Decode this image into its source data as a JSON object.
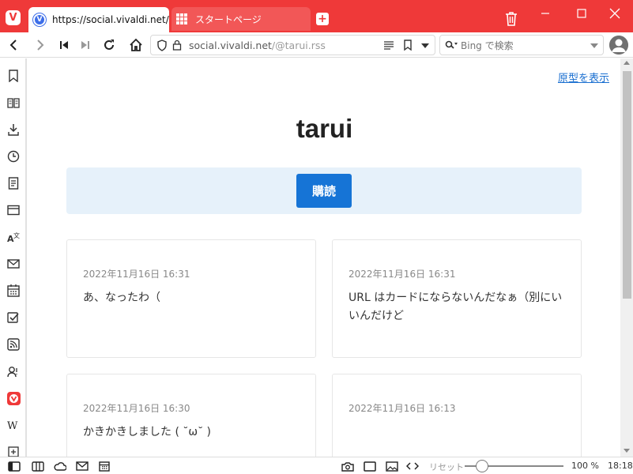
{
  "browser": {
    "name": "Vivaldi",
    "logo_letter": "V",
    "accent_color": "#ef3939"
  },
  "tabs": [
    {
      "title": "https://social.vivaldi.net/@tarui.rss",
      "favicon": "vivaldi-social-icon",
      "active": true
    },
    {
      "title": "スタートページ",
      "favicon": "grid-icon",
      "active": false
    }
  ],
  "address_bar": {
    "url_domain": "social.vivaldi.net",
    "url_path": "/@tarui.rss"
  },
  "search": {
    "engine": "Bing",
    "placeholder": "Bing で検索"
  },
  "page": {
    "show_original_link": "原型を表示",
    "title": "tarui",
    "subscribe_label": "購読",
    "subscribe_color": "#1674d6",
    "band_color": "#e6f1fa",
    "posts": [
      {
        "date": "2022年11月16日 16:31",
        "text": "あ、なったわ（"
      },
      {
        "date": "2022年11月16日 16:31",
        "text": "URL はカードにならないんだなぁ（別にいいんだけど"
      },
      {
        "date": "2022年11月16日 16:30",
        "text": "かきかきしました ( ˘ω˘ )"
      },
      {
        "date": "2022年11月16日 16:13",
        "text": ""
      }
    ]
  },
  "sidepanel": {
    "icons": [
      "bookmark-icon",
      "reading-list-icon",
      "downloads-icon",
      "history-icon",
      "notes-icon",
      "window-panel-icon",
      "translate-icon",
      "mail-icon",
      "calendar-icon",
      "tasks-icon",
      "feeds-icon",
      "contacts-icon",
      "vivaldi-web-panel-icon",
      "wikipedia-panel-icon",
      "add-panel-icon"
    ]
  },
  "statusbar": {
    "reset_label": "リセット",
    "zoom": "100 %",
    "zoom_percent": 100,
    "time": "18:18"
  }
}
